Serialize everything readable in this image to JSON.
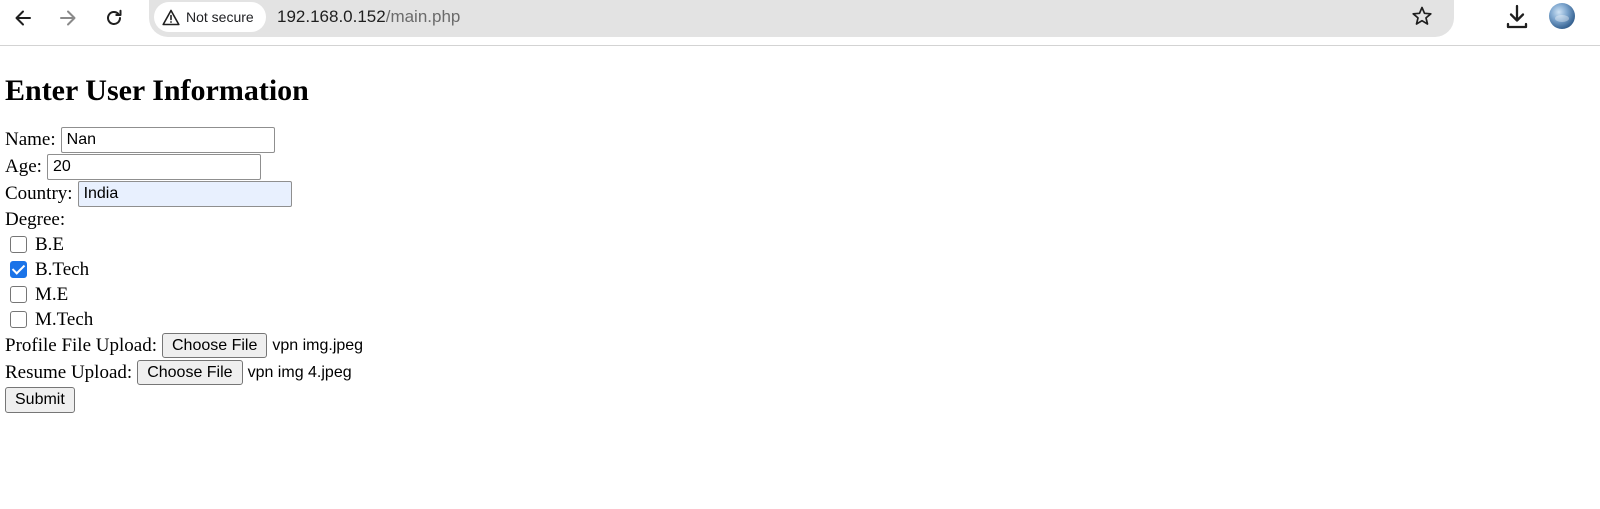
{
  "browser": {
    "security_label": "Not secure",
    "url_host": "192.168.0.152",
    "url_path": "/main.php",
    "icons": {
      "back": "arrow-left-icon",
      "forward": "arrow-right-icon",
      "reload": "reload-icon",
      "security": "warning-triangle-icon",
      "bookmark": "star-icon",
      "download": "download-icon",
      "profile": "profile-avatar"
    }
  },
  "form": {
    "title": "Enter User Information",
    "name_label": "Name:",
    "name_value": "Nan",
    "age_label": "Age:",
    "age_value": "20",
    "country_label": "Country:",
    "country_value": "India",
    "degree_label": "Degree:",
    "degrees": [
      {
        "label": "B.E",
        "checked": false
      },
      {
        "label": "B.Tech",
        "checked": true
      },
      {
        "label": "M.E",
        "checked": false
      },
      {
        "label": "M.Tech",
        "checked": false
      }
    ],
    "profile_label": "Profile File Upload:",
    "profile_button": "Choose File",
    "profile_file": "vpn img.jpeg",
    "resume_label": "Resume Upload:",
    "resume_button": "Choose File",
    "resume_file": "vpn img 4.jpeg",
    "submit_label": "Submit"
  },
  "colors": {
    "accent": "#1a73e8",
    "omnibox": "#e3e3e3",
    "autofill": "#e8f0fe"
  }
}
